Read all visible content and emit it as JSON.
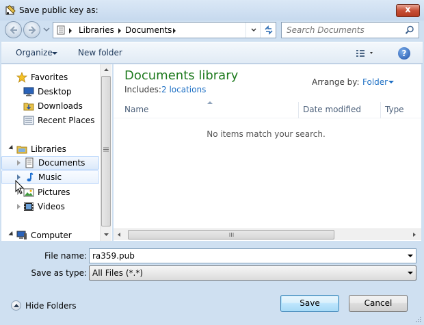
{
  "window": {
    "title": "Save public key as:",
    "close_glyph": "x"
  },
  "address": {
    "crumbs": [
      "Libraries",
      "Documents"
    ],
    "search_placeholder": "Search Documents"
  },
  "toolbar": {
    "organize": "Organize",
    "new_folder": "New folder",
    "help": "?"
  },
  "navpane": {
    "favorites": "Favorites",
    "desktop": "Desktop",
    "downloads": "Downloads",
    "recent_places": "Recent Places",
    "libraries": "Libraries",
    "documents": "Documents",
    "music": "Music",
    "pictures": "Pictures",
    "videos": "Videos",
    "computer": "Computer"
  },
  "content": {
    "library_title": "Documents library",
    "includes_label": "Includes:",
    "includes_value": "2 locations",
    "arrange_label": "Arrange by:",
    "arrange_value": "Folder",
    "columns": [
      "Name",
      "Date modified",
      "Type"
    ],
    "empty_message": "No items match your search."
  },
  "form": {
    "filename_label": "File name:",
    "filename_value": "ra359.pub",
    "savetype_label": "Save as type:",
    "savetype_value": "All Files (*.*)"
  },
  "footer": {
    "hide_folders": "Hide Folders",
    "save": "Save",
    "cancel": "Cancel"
  },
  "icons": {
    "star": "favorites-star-icon",
    "accent": "#1e7a1e",
    "link": "#1d6fc4"
  }
}
